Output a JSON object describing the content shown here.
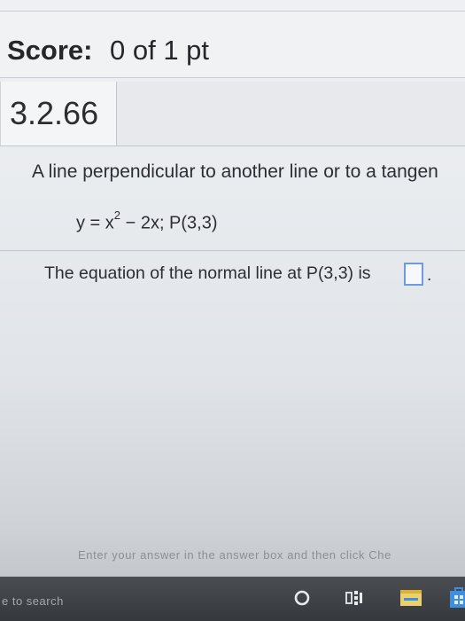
{
  "score": {
    "label": "Score:",
    "value": "0 of 1 pt"
  },
  "problem": {
    "number": "3.2.66"
  },
  "question": {
    "prompt": "A line perpendicular to another line or to a tangen",
    "equation_prefix": "y = x",
    "equation_exponent": "2",
    "equation_suffix": " − 2x; P(3,3)",
    "answer_text": "The equation of the normal line at P(3,3) is",
    "answer_value": "",
    "answer_period": "."
  },
  "footer": {
    "instruction": "Enter your answer in the answer box and then click Che"
  },
  "taskbar": {
    "search_text": "e to search",
    "icons": [
      "cortana-icon",
      "task-view-icon",
      "file-explorer-icon",
      "store-icon"
    ]
  },
  "colors": {
    "answer_box_border": "#6d9be3",
    "taskbar": "#3b3e42",
    "store_accent": "#3f8fe0",
    "files_accent": "#e8c44a"
  }
}
